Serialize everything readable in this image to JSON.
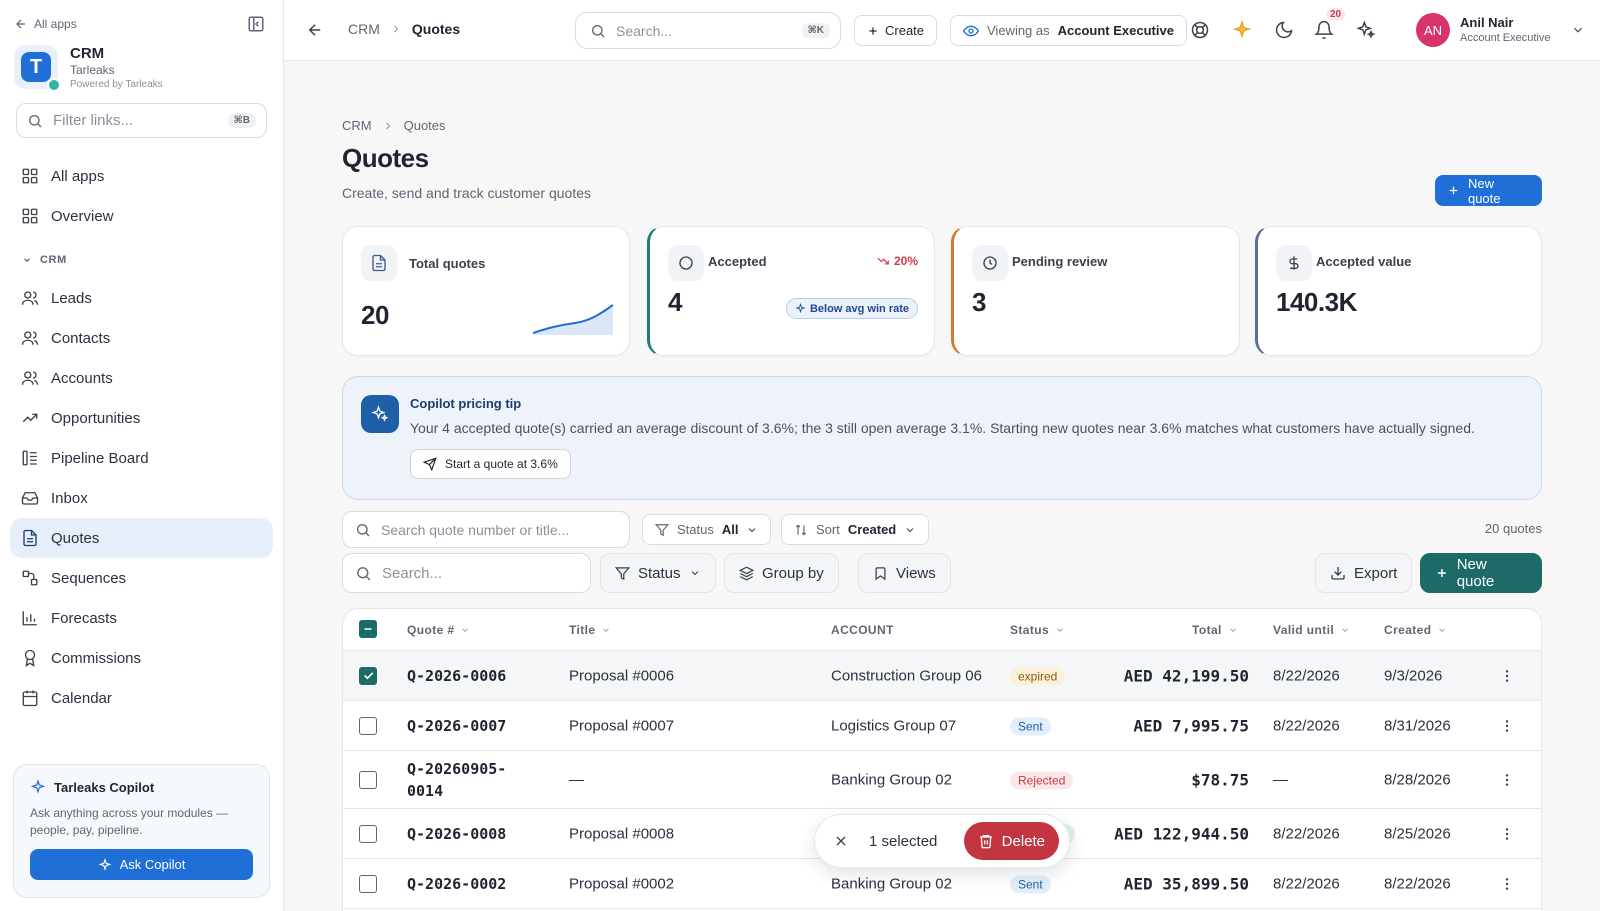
{
  "sidebar": {
    "all_apps_link": "All apps",
    "org": {
      "logo_letter": "T",
      "name": "CRM",
      "company": "Tarleaks",
      "powered": "Powered by Tarleaks"
    },
    "filter": {
      "placeholder": "Filter links...",
      "shortcut": "⌘B"
    },
    "top_items": [
      {
        "label": "All apps",
        "icon": "grid-icon"
      },
      {
        "label": "Overview",
        "icon": "grid-icon"
      }
    ],
    "section_label": "CRM",
    "items": [
      {
        "label": "Leads",
        "icon": "users-icon"
      },
      {
        "label": "Contacts",
        "icon": "users-icon"
      },
      {
        "label": "Accounts",
        "icon": "users-icon"
      },
      {
        "label": "Opportunities",
        "icon": "trending-up-icon"
      },
      {
        "label": "Pipeline Board",
        "icon": "kanban-icon"
      },
      {
        "label": "Inbox",
        "icon": "inbox-icon"
      },
      {
        "label": "Quotes",
        "icon": "file-icon",
        "active": true
      },
      {
        "label": "Sequences",
        "icon": "sequence-icon"
      },
      {
        "label": "Forecasts",
        "icon": "bar-chart-icon"
      },
      {
        "label": "Commissions",
        "icon": "award-icon"
      },
      {
        "label": "Calendar",
        "icon": "calendar-icon"
      }
    ],
    "copilot": {
      "title": "Tarleaks Copilot",
      "desc": "Ask anything across your modules — people, pay, pipeline.",
      "button": "Ask Copilot"
    }
  },
  "topbar": {
    "crumb_root": "CRM",
    "crumb_current": "Quotes",
    "search_placeholder": "Search...",
    "search_shortcut": "⌘K",
    "create_label": "Create",
    "viewing_prefix": "Viewing as",
    "viewing_role": "Account Executive",
    "notifications_count": "20",
    "user": {
      "initials": "AN",
      "name": "Anil Nair",
      "role": "Account Executive"
    }
  },
  "page": {
    "crumb_root": "CRM",
    "crumb_current": "Quotes",
    "title": "Quotes",
    "subtitle": "Create, send and track customer quotes",
    "new_quote_label": "New quote"
  },
  "stats": {
    "total": {
      "label": "Total quotes",
      "value": "20"
    },
    "accepted": {
      "label": "Accepted",
      "value": "4",
      "delta": "20%",
      "chip": "Below avg win rate"
    },
    "pending": {
      "label": "Pending review",
      "value": "3"
    },
    "value": {
      "label": "Accepted value",
      "value": "140.3K"
    }
  },
  "tip": {
    "title": "Copilot pricing tip",
    "text": "Your 4 accepted quote(s) carried an average discount of 3.6%; the 3 still open average 3.1%. Starting new quotes near 3.6% matches what customers have actually signed.",
    "button": "Start a quote at 3.6%"
  },
  "filters": {
    "search_placeholder": "Search quote number or title...",
    "status_label": "Status",
    "status_value": "All",
    "sort_label": "Sort",
    "sort_value": "Created",
    "count": "20 quotes"
  },
  "toolbar": {
    "search_placeholder": "Search...",
    "status": "Status",
    "group_by": "Group by",
    "views": "Views",
    "export": "Export",
    "new_quote": "New quote"
  },
  "table": {
    "headers": {
      "quote": "Quote #",
      "title": "Title",
      "account": "ACCOUNT",
      "status": "Status",
      "total": "Total",
      "valid": "Valid until",
      "created": "Created"
    },
    "rows": [
      {
        "quote": "Q-2026-0006",
        "title": "Proposal #0006",
        "account": "Construction Group 06",
        "status": "expired",
        "total": "AED 42,199.50",
        "valid": "8/22/2026",
        "created": "9/3/2026",
        "checked": true
      },
      {
        "quote": "Q-2026-0007",
        "title": "Proposal #0007",
        "account": "Logistics Group 07",
        "status": "Sent",
        "total": "AED 7,995.75",
        "valid": "8/22/2026",
        "created": "8/31/2026",
        "checked": false
      },
      {
        "quote_l1": "Q-20260905-",
        "quote_l2": "0014",
        "title": "—",
        "account": "Banking Group 02",
        "status": "Rejected",
        "total": "$78.75",
        "valid": "—",
        "created": "8/28/2026",
        "checked": false
      },
      {
        "quote": "Q-2026-0008",
        "title": "Proposal #0008",
        "account": "",
        "status": "",
        "total": "AED 122,944.50",
        "valid": "8/22/2026",
        "created": "8/25/2026",
        "checked": false
      },
      {
        "quote": "Q-2026-0002",
        "title": "Proposal #0002",
        "account": "Banking Group 02",
        "status": "Sent",
        "total": "AED 35,899.50",
        "valid": "8/22/2026",
        "created": "8/22/2026",
        "checked": false
      }
    ]
  },
  "selection": {
    "count": "1 selected",
    "delete": "Delete"
  }
}
